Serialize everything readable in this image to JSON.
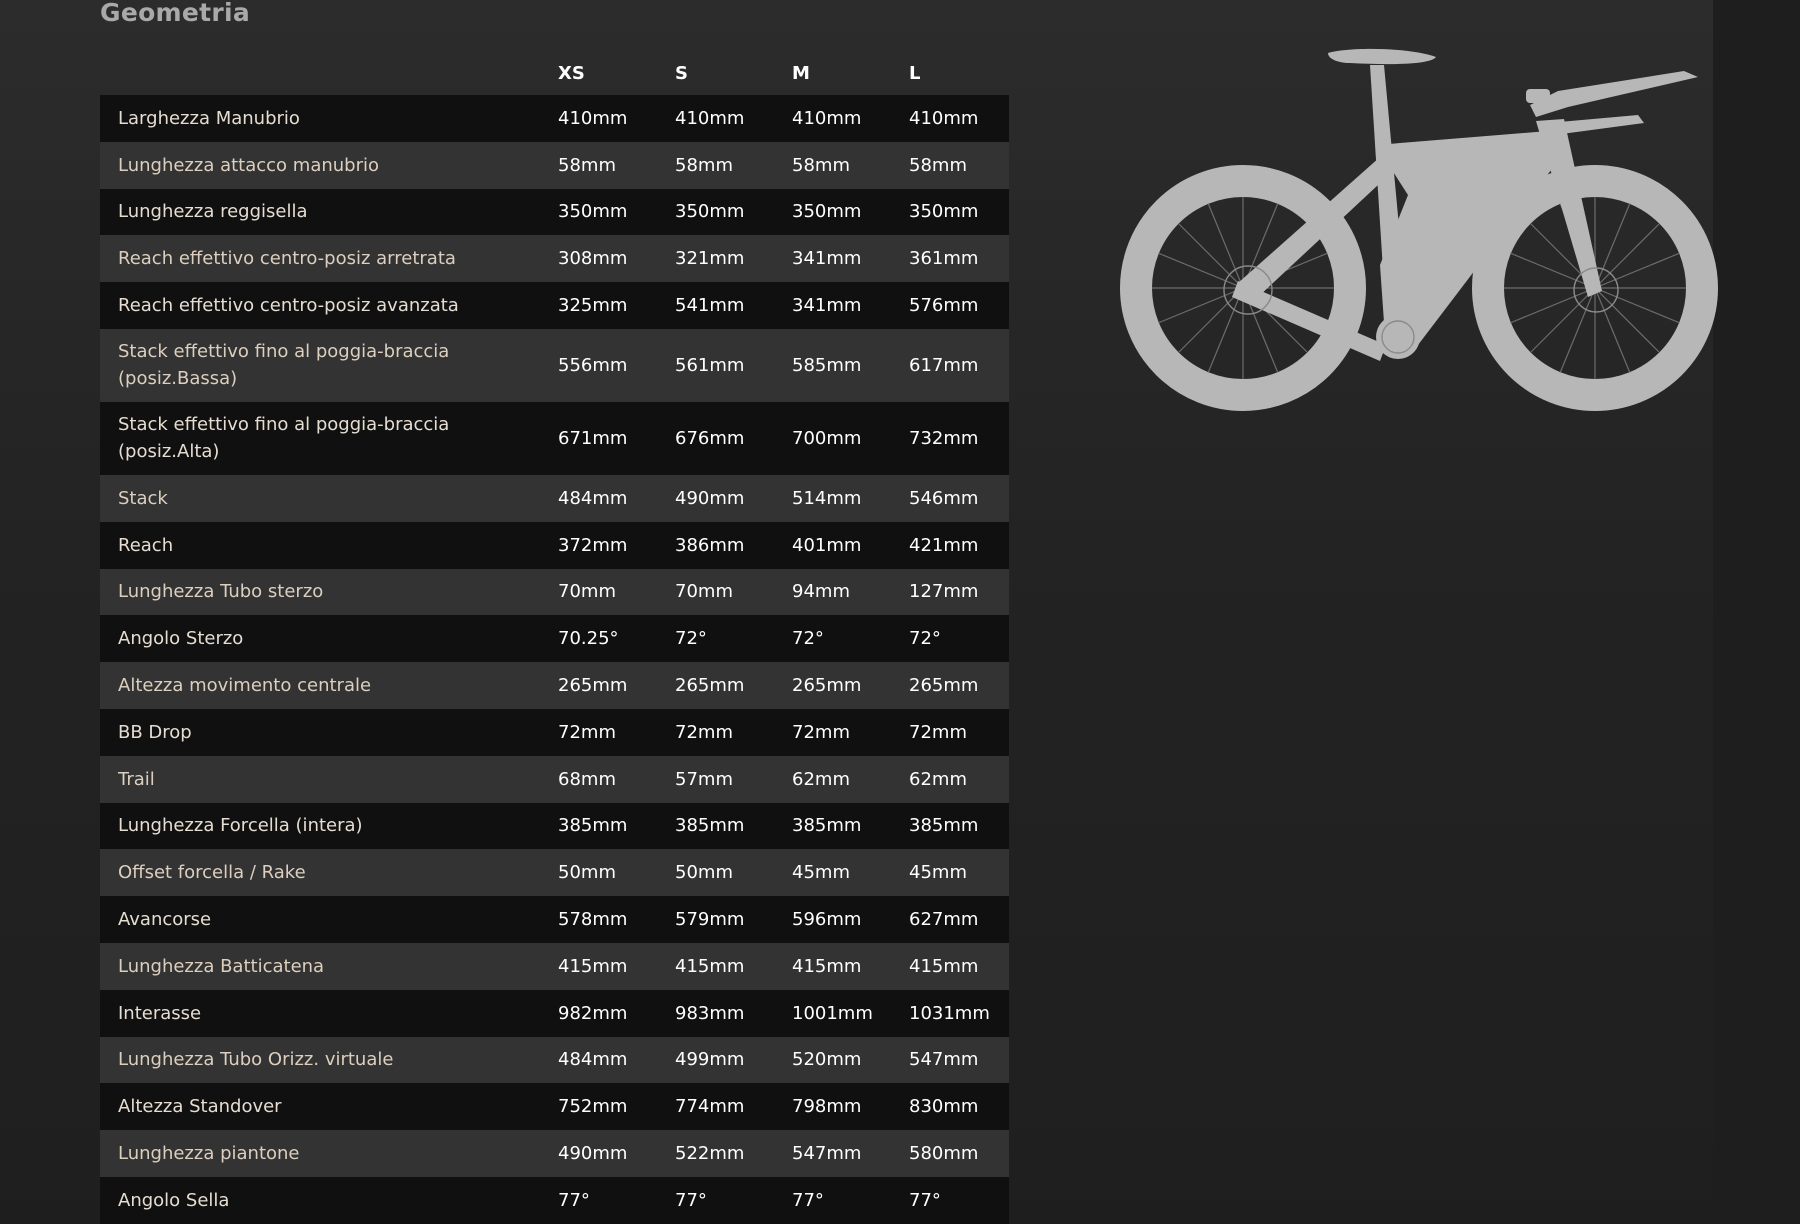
{
  "page": {
    "title": "Geometria"
  },
  "table": {
    "sizes": [
      "XS",
      "S",
      "M",
      "L"
    ],
    "rows": [
      {
        "label": "Larghezza Manubrio",
        "values": [
          "410mm",
          "410mm",
          "410mm",
          "410mm"
        ]
      },
      {
        "label": "Lunghezza attacco manubrio",
        "values": [
          "58mm",
          "58mm",
          "58mm",
          "58mm"
        ]
      },
      {
        "label": "Lunghezza reggisella",
        "values": [
          "350mm",
          "350mm",
          "350mm",
          "350mm"
        ]
      },
      {
        "label": "Reach effettivo centro-posiz arretrata",
        "values": [
          "308mm",
          "321mm",
          "341mm",
          "361mm"
        ]
      },
      {
        "label": "Reach effettivo centro-posiz avanzata",
        "values": [
          "325mm",
          "541mm",
          "341mm",
          "576mm"
        ]
      },
      {
        "label": "Stack effettivo fino al poggia-braccia (posiz.Bassa)",
        "values": [
          "556mm",
          "561mm",
          "585mm",
          "617mm"
        ]
      },
      {
        "label": "Stack effettivo fino al poggia-braccia (posiz.Alta)",
        "values": [
          "671mm",
          "676mm",
          "700mm",
          "732mm"
        ]
      },
      {
        "label": "Stack",
        "values": [
          "484mm",
          "490mm",
          "514mm",
          "546mm"
        ]
      },
      {
        "label": "Reach",
        "values": [
          "372mm",
          "386mm",
          "401mm",
          "421mm"
        ]
      },
      {
        "label": "Lunghezza Tubo sterzo",
        "values": [
          "70mm",
          "70mm",
          "94mm",
          "127mm"
        ]
      },
      {
        "label": "Angolo Sterzo",
        "values": [
          "70.25°",
          "72°",
          "72°",
          "72°"
        ]
      },
      {
        "label": "Altezza movimento centrale",
        "values": [
          "265mm",
          "265mm",
          "265mm",
          "265mm"
        ]
      },
      {
        "label": "BB Drop",
        "values": [
          "72mm",
          "72mm",
          "72mm",
          "72mm"
        ]
      },
      {
        "label": "Trail",
        "values": [
          "68mm",
          "57mm",
          "62mm",
          "62mm"
        ]
      },
      {
        "label": "Lunghezza Forcella (intera)",
        "values": [
          "385mm",
          "385mm",
          "385mm",
          "385mm"
        ]
      },
      {
        "label": "Offset forcella / Rake",
        "values": [
          "50mm",
          "50mm",
          "45mm",
          "45mm"
        ]
      },
      {
        "label": "Avancorse",
        "values": [
          "578mm",
          "579mm",
          "596mm",
          "627mm"
        ]
      },
      {
        "label": "Lunghezza Batticatena",
        "values": [
          "415mm",
          "415mm",
          "415mm",
          "415mm"
        ]
      },
      {
        "label": "Interasse",
        "values": [
          "982mm",
          "983mm",
          "1001mm",
          "1031mm"
        ]
      },
      {
        "label": "Lunghezza Tubo Orizz. virtuale",
        "values": [
          "484mm",
          "499mm",
          "520mm",
          "547mm"
        ]
      },
      {
        "label": "Altezza Standover",
        "values": [
          "752mm",
          "774mm",
          "798mm",
          "830mm"
        ]
      },
      {
        "label": "Lunghezza piantone",
        "values": [
          "490mm",
          "522mm",
          "547mm",
          "580mm"
        ]
      },
      {
        "label": "Angolo Sella",
        "values": [
          "77°",
          "77°",
          "77°",
          "77°"
        ]
      }
    ]
  },
  "bike_illustration": {
    "icon": "bike-silhouette-icon",
    "color": "#b7b7b7"
  },
  "colors": {
    "background": "#1e1e1e",
    "row_dark": "#101010",
    "row_light": "#333333",
    "title": "#a9a9a9"
  }
}
